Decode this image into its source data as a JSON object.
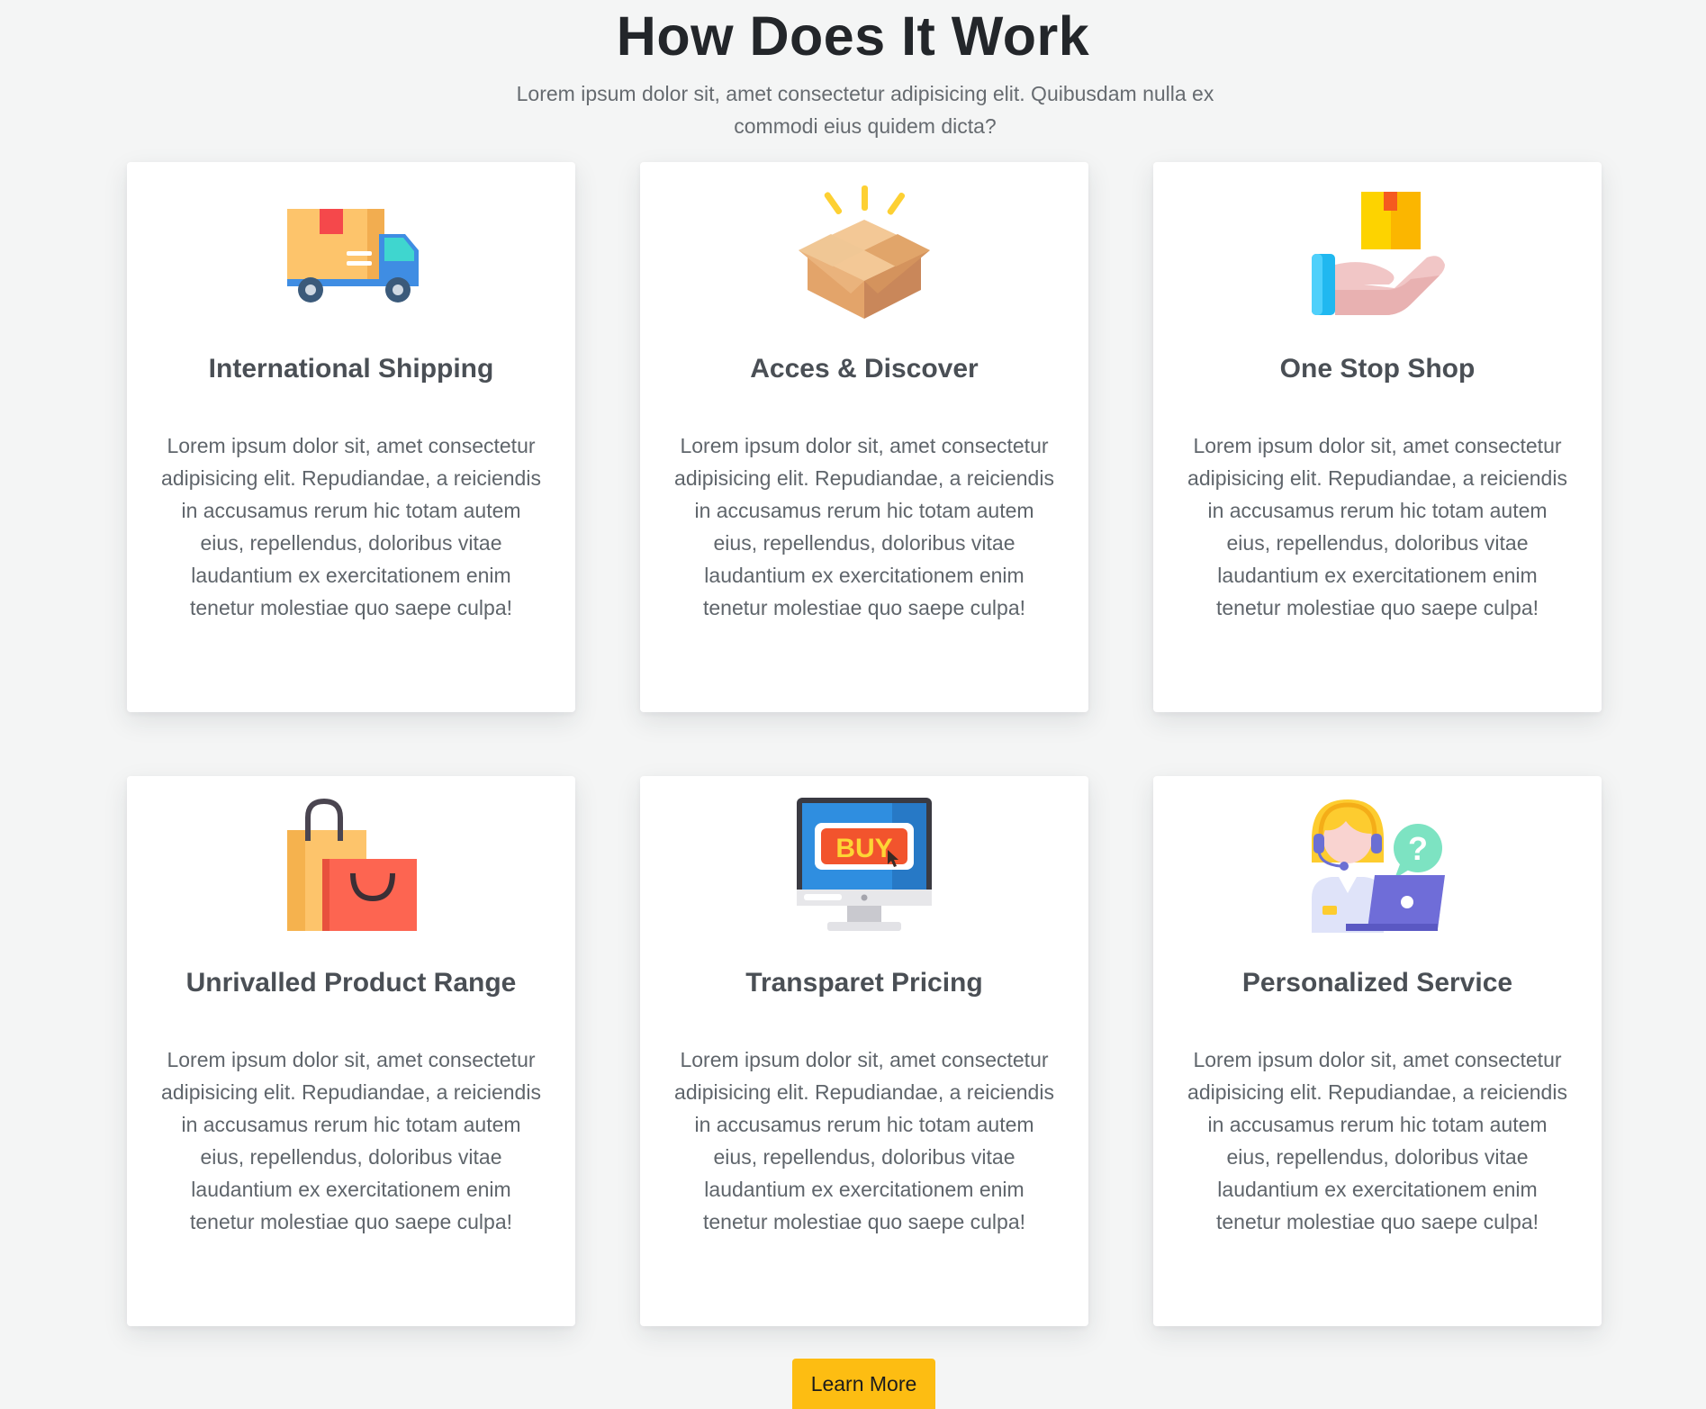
{
  "section": {
    "title": "How Does It Work",
    "subtitle": "Lorem ipsum dolor sit, amet consectetur adipisicing elit. Quibusdam nulla ex commodi eius quidem dicta?"
  },
  "cards": [
    {
      "icon": "delivery-truck-icon",
      "title": "International Shipping",
      "text": "Lorem ipsum dolor sit, amet consectetur adipisicing elit. Repudiandae, a reiciendis in accusamus rerum hic totam autem eius, repellendus, doloribus vitae laudantium ex exercitationem enim tenetur molestiae quo saepe culpa!"
    },
    {
      "icon": "open-box-icon",
      "title": "Acces & Discover",
      "text": "Lorem ipsum dolor sit, amet consectetur adipisicing elit. Repudiandae, a reiciendis in accusamus rerum hic totam autem eius, repellendus, doloribus vitae laudantium ex exercitationem enim tenetur molestiae quo saepe culpa!"
    },
    {
      "icon": "hand-with-box-icon",
      "title": "One Stop Shop",
      "text": "Lorem ipsum dolor sit, amet consectetur adipisicing elit. Repudiandae, a reiciendis in accusamus rerum hic totam autem eius, repellendus, doloribus vitae laudantium ex exercitationem enim tenetur molestiae quo saepe culpa!"
    },
    {
      "icon": "shopping-bags-icon",
      "title": "Unrivalled Product Range",
      "text": "Lorem ipsum dolor sit, amet consectetur adipisicing elit. Repudiandae, a reiciendis in accusamus rerum hic totam autem eius, repellendus, doloribus vitae laudantium ex exercitationem enim tenetur molestiae quo saepe culpa!"
    },
    {
      "icon": "buy-monitor-icon",
      "title": "Transparet Pricing",
      "icon_label": "BUY",
      "text": "Lorem ipsum dolor sit, amet consectetur adipisicing elit. Repudiandae, a reiciendis in accusamus rerum hic totam autem eius, repellendus, doloribus vitae laudantium ex exercitationem enim tenetur molestiae quo saepe culpa!"
    },
    {
      "icon": "support-agent-icon",
      "title": "Personalized Service",
      "icon_label": "?",
      "text": "Lorem ipsum dolor sit, amet consectetur adipisicing elit. Repudiandae, a reiciendis in accusamus rerum hic totam autem eius, repellendus, doloribus vitae laudantium ex exercitationem enim tenetur molestiae quo saepe culpa!"
    }
  ],
  "button": {
    "label": "Learn More"
  },
  "colors": {
    "background": "#f4f5f5",
    "card": "#ffffff",
    "accent": "#fdbd12",
    "title": "#23262a",
    "text": "#5f656b"
  }
}
